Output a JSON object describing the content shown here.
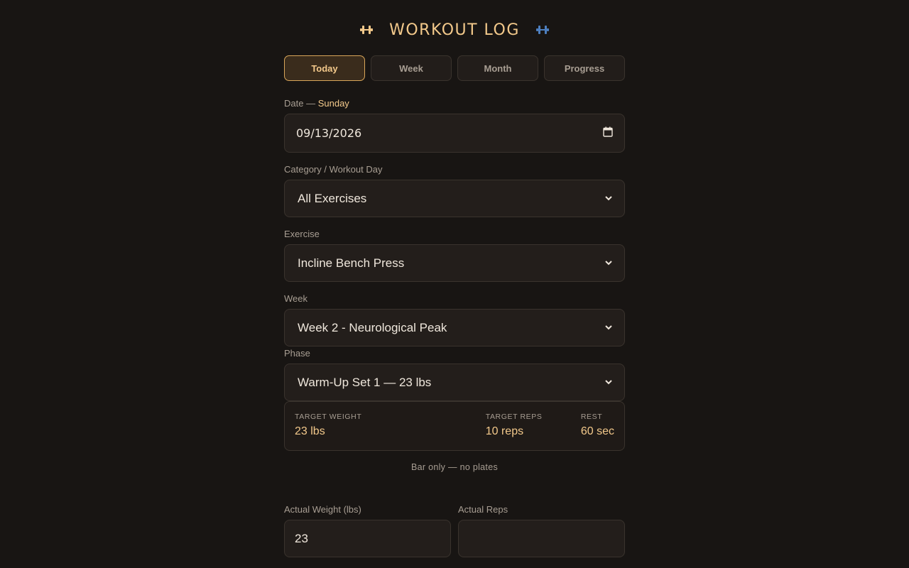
{
  "header": {
    "title": "WORKOUT LOG",
    "left_icon": "dumbbell-icon",
    "right_icon": "dumbbell-icon",
    "left_icon_color": "#f3c98b",
    "right_icon_color": "#4d7fbf"
  },
  "tabs": [
    {
      "label": "Today",
      "active": true
    },
    {
      "label": "Week",
      "active": false
    },
    {
      "label": "Month",
      "active": false
    },
    {
      "label": "Progress",
      "active": false
    }
  ],
  "date": {
    "label": "Date —",
    "day": "Sunday",
    "value": "09/13/2026",
    "icon": "calendar-icon"
  },
  "category": {
    "label": "Category / Workout Day",
    "value": "All Exercises"
  },
  "exercise": {
    "label": "Exercise",
    "value": "Incline Bench Press"
  },
  "week": {
    "label": "Week",
    "value": "Week 2 - Neurological Peak"
  },
  "phase": {
    "label": "Phase",
    "value": "Warm-Up Set 1 — 23 lbs"
  },
  "targets": {
    "weight_label": "TARGET WEIGHT",
    "weight_value": "23 lbs",
    "reps_label": "TARGET REPS",
    "reps_value": "10 reps",
    "rest_label": "REST",
    "rest_value": "60 sec"
  },
  "note": "Bar only — no plates",
  "actual": {
    "weight_label": "Actual Weight (lbs)",
    "weight_value": "23",
    "reps_label": "Actual Reps",
    "reps_value": ""
  },
  "colors": {
    "accent": "#f3c98b",
    "background": "#181513",
    "secondary_accent": "#4d7fbf"
  }
}
